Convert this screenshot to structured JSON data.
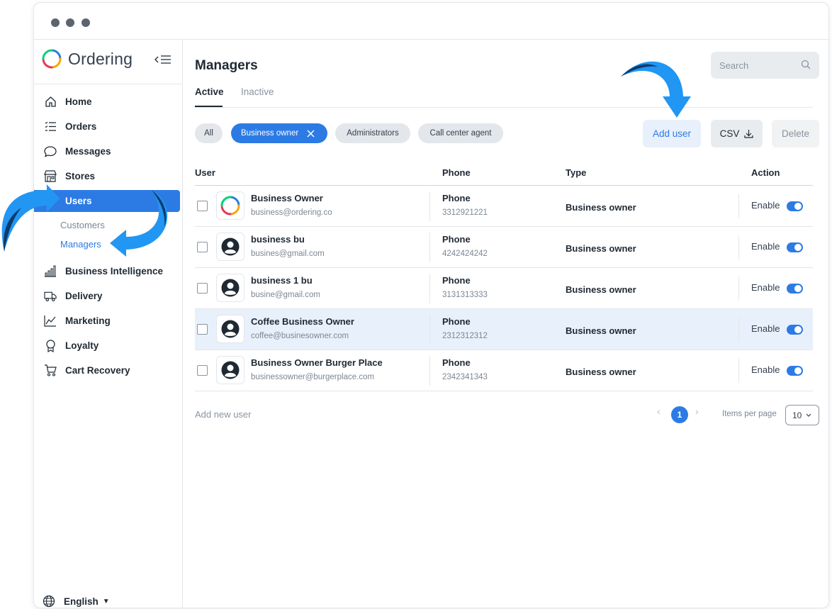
{
  "app": {
    "name": "Ordering",
    "window_dots": 3
  },
  "sidebar": {
    "items": [
      {
        "label": "Home",
        "icon": "home-icon"
      },
      {
        "label": "Orders",
        "icon": "list-icon"
      },
      {
        "label": "Messages",
        "icon": "message-icon"
      },
      {
        "label": "Stores",
        "icon": "store-icon"
      },
      {
        "label": "Users",
        "icon": "users-icon",
        "active": true
      },
      {
        "label": "Business Intelligence",
        "icon": "bar-chart-icon"
      },
      {
        "label": "Delivery",
        "icon": "truck-icon"
      },
      {
        "label": "Marketing",
        "icon": "line-chart-icon"
      },
      {
        "label": "Loyalty",
        "icon": "award-icon"
      },
      {
        "label": "Cart Recovery",
        "icon": "cart-icon"
      }
    ],
    "sub_items": [
      {
        "label": "Customers"
      },
      {
        "label": "Managers",
        "active": true
      }
    ],
    "language": "English"
  },
  "main": {
    "title": "Managers",
    "search_placeholder": "Search",
    "tabs": [
      {
        "label": "Active",
        "active": true
      },
      {
        "label": "Inactive"
      }
    ],
    "filters": [
      {
        "label": "All"
      },
      {
        "label": "Business owner",
        "active": true
      },
      {
        "label": "Administrators"
      },
      {
        "label": "Call center agent"
      }
    ],
    "buttons": {
      "add_user": "Add user",
      "csv": "CSV",
      "delete": "Delete"
    },
    "table": {
      "headers": {
        "user": "User",
        "phone": "Phone",
        "type": "Type",
        "action": "Action"
      },
      "rows": [
        {
          "name": "Business Owner",
          "email": "business@ordering.co",
          "phone_label": "Phone",
          "phone": "3312921221",
          "type": "Business owner",
          "action": "Enable",
          "avatar": "ordering-logo",
          "highlight": false
        },
        {
          "name": "business bu",
          "email": "busines@gmail.com",
          "phone_label": "Phone",
          "phone": "4242424242",
          "type": "Business owner",
          "action": "Enable",
          "avatar": "user-avatar-icon",
          "highlight": false
        },
        {
          "name": "business 1 bu",
          "email": "busine@gmail.com",
          "phone_label": "Phone",
          "phone": "3131313333",
          "type": "Business owner",
          "action": "Enable",
          "avatar": "user-avatar-icon",
          "highlight": false
        },
        {
          "name": "Coffee Business Owner",
          "email": "coffee@businesowner.com",
          "phone_label": "Phone",
          "phone": "2312312312",
          "type": "Business owner",
          "action": "Enable",
          "avatar": "user-avatar-icon",
          "highlight": true
        },
        {
          "name": "Business Owner Burger Place",
          "email": "businessowner@burgerplace.com",
          "phone_label": "Phone",
          "phone": "2342341343",
          "type": "Business owner",
          "action": "Enable",
          "avatar": "user-avatar-icon",
          "highlight": false
        }
      ]
    },
    "footer": {
      "add_new_user": "Add new user",
      "current_page": "1",
      "items_per_page_label": "Items per page",
      "items_per_page": "10"
    }
  },
  "colors": {
    "accent": "#2c7be5",
    "arrow": "#2196f3",
    "arrow_dark": "#0d3a6b"
  }
}
